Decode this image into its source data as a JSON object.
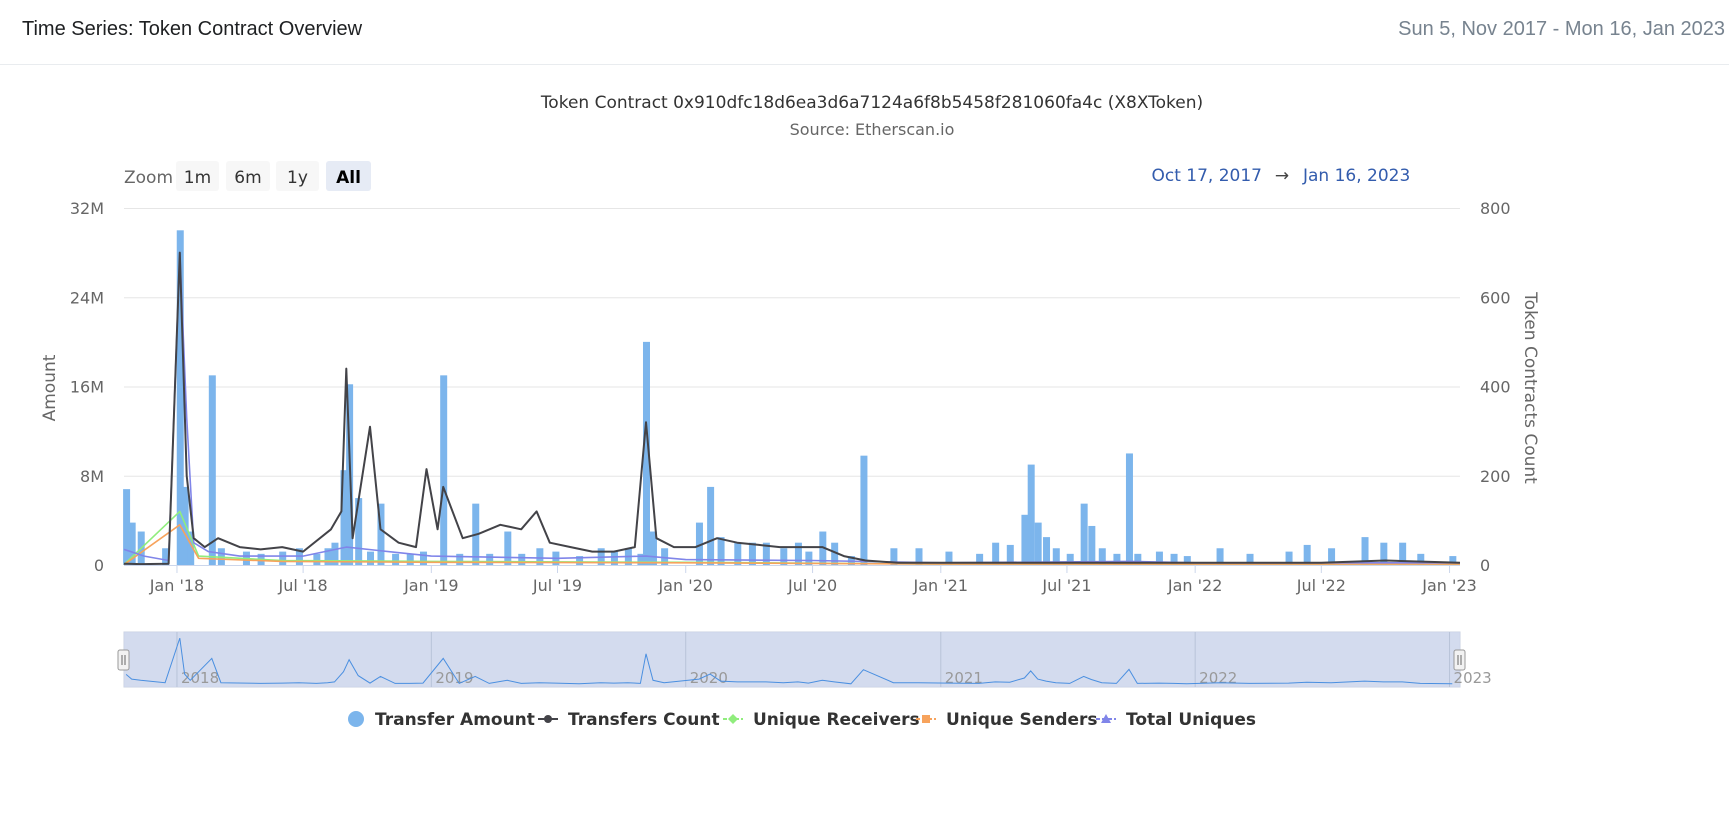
{
  "header": {
    "title": "Time Series: Token Contract Overview",
    "date_range": "Sun 5, Nov 2017 - Mon 16, Jan 2023"
  },
  "zoom": {
    "label": "Zoom",
    "buttons": [
      "1m",
      "6m",
      "1y",
      "All"
    ],
    "active": "All"
  },
  "range_display": {
    "from": "Oct 17, 2017",
    "arrow": "→",
    "to": "Jan 16, 2023"
  },
  "colors": {
    "transfer_amount": "#7cb5ec",
    "transfers_count": "#434348",
    "unique_receivers": "#90ed7d",
    "unique_senders": "#f7a35c",
    "total_uniques": "#8085e9",
    "navigator_fill": "#ccd6eb",
    "range_text": "#335cad"
  },
  "chart_data": {
    "type": "bar",
    "title": "Token Contract 0x910dfc18d6ea3d6a7124a6f8b5458f281060fa4c (X8XToken)",
    "subtitle": "Source: Etherscan.io",
    "xlabel": "",
    "ylabel": "Amount",
    "y2label": "Token Contracts Count",
    "x_range": [
      "2017-10-17",
      "2023-01-16"
    ],
    "ylim": [
      0,
      32000000
    ],
    "y2lim": [
      0,
      800
    ],
    "x_ticks": [
      "Jan '18",
      "Jul '18",
      "Jan '19",
      "Jul '19",
      "Jan '20",
      "Jul '20",
      "Jan '21",
      "Jul '21",
      "Jan '22",
      "Jul '22",
      "Jan '23"
    ],
    "x_tick_dates": [
      "2018-01-01",
      "2018-07-01",
      "2019-01-01",
      "2019-07-01",
      "2020-01-01",
      "2020-07-01",
      "2021-01-01",
      "2021-07-01",
      "2022-01-01",
      "2022-07-01",
      "2023-01-01"
    ],
    "y_ticks": [
      "0",
      "8M",
      "16M",
      "24M",
      "32M"
    ],
    "y_tick_values": [
      0,
      8000000,
      16000000,
      24000000,
      32000000
    ],
    "y2_ticks": [
      "0",
      "200",
      "400",
      "600",
      "800"
    ],
    "y2_tick_values": [
      0,
      200,
      400,
      600,
      800
    ],
    "navigator_years": [
      "2018",
      "2019",
      "2020",
      "2021",
      "2022",
      "2023"
    ],
    "navigator_year_dates": [
      "2018-01-01",
      "2019-01-01",
      "2020-01-01",
      "2021-01-01",
      "2022-01-01",
      "2023-01-01"
    ],
    "grid": true,
    "legend_position": "bottom",
    "series": [
      {
        "name": "Transfer Amount",
        "type": "bar",
        "axis": "left",
        "points": [
          [
            "2017-10-20",
            6800000
          ],
          [
            "2017-10-28",
            3800000
          ],
          [
            "2017-11-10",
            3000000
          ],
          [
            "2017-12-15",
            1500000
          ],
          [
            "2018-01-05",
            30000000
          ],
          [
            "2018-01-12",
            7000000
          ],
          [
            "2018-01-20",
            3000000
          ],
          [
            "2018-02-20",
            17000000
          ],
          [
            "2018-03-05",
            1500000
          ],
          [
            "2018-04-10",
            1200000
          ],
          [
            "2018-05-01",
            1000000
          ],
          [
            "2018-06-01",
            1200000
          ],
          [
            "2018-06-25",
            1500000
          ],
          [
            "2018-07-20",
            1000000
          ],
          [
            "2018-08-05",
            1500000
          ],
          [
            "2018-08-15",
            2000000
          ],
          [
            "2018-08-28",
            8500000
          ],
          [
            "2018-09-05",
            16200000
          ],
          [
            "2018-09-18",
            6000000
          ],
          [
            "2018-10-05",
            1200000
          ],
          [
            "2018-10-20",
            5500000
          ],
          [
            "2018-11-10",
            1000000
          ],
          [
            "2018-12-01",
            1000000
          ],
          [
            "2018-12-20",
            1200000
          ],
          [
            "2019-01-18",
            17000000
          ],
          [
            "2019-02-10",
            1000000
          ],
          [
            "2019-03-05",
            5500000
          ],
          [
            "2019-03-25",
            1000000
          ],
          [
            "2019-04-20",
            3000000
          ],
          [
            "2019-05-10",
            1000000
          ],
          [
            "2019-06-05",
            1500000
          ],
          [
            "2019-06-28",
            1200000
          ],
          [
            "2019-08-01",
            800000
          ],
          [
            "2019-09-01",
            1500000
          ],
          [
            "2019-09-20",
            1200000
          ],
          [
            "2019-10-10",
            1500000
          ],
          [
            "2019-10-28",
            1000000
          ],
          [
            "2019-11-05",
            20000000
          ],
          [
            "2019-11-15",
            3000000
          ],
          [
            "2019-12-01",
            1500000
          ],
          [
            "2020-01-20",
            3800000
          ],
          [
            "2020-02-05",
            7000000
          ],
          [
            "2020-02-20",
            2500000
          ],
          [
            "2020-03-15",
            2000000
          ],
          [
            "2020-04-05",
            2000000
          ],
          [
            "2020-04-25",
            2000000
          ],
          [
            "2020-05-20",
            1500000
          ],
          [
            "2020-06-10",
            2000000
          ],
          [
            "2020-06-25",
            1200000
          ],
          [
            "2020-07-15",
            3000000
          ],
          [
            "2020-08-01",
            2000000
          ],
          [
            "2020-08-25",
            800000
          ],
          [
            "2020-09-12",
            9800000
          ],
          [
            "2020-10-25",
            1500000
          ],
          [
            "2020-11-30",
            1500000
          ],
          [
            "2021-01-12",
            1200000
          ],
          [
            "2021-02-25",
            1000000
          ],
          [
            "2021-03-20",
            2000000
          ],
          [
            "2021-04-10",
            1800000
          ],
          [
            "2021-05-01",
            4500000
          ],
          [
            "2021-05-10",
            9000000
          ],
          [
            "2021-05-20",
            3800000
          ],
          [
            "2021-06-01",
            2500000
          ],
          [
            "2021-06-15",
            1500000
          ],
          [
            "2021-07-05",
            1000000
          ],
          [
            "2021-07-25",
            5500000
          ],
          [
            "2021-08-05",
            3500000
          ],
          [
            "2021-08-20",
            1500000
          ],
          [
            "2021-09-10",
            1000000
          ],
          [
            "2021-09-28",
            10000000
          ],
          [
            "2021-10-10",
            1000000
          ],
          [
            "2021-11-10",
            1200000
          ],
          [
            "2021-12-01",
            1000000
          ],
          [
            "2021-12-20",
            800000
          ],
          [
            "2022-02-05",
            1500000
          ],
          [
            "2022-03-20",
            1000000
          ],
          [
            "2022-05-15",
            1200000
          ],
          [
            "2022-06-10",
            1800000
          ],
          [
            "2022-07-15",
            1500000
          ],
          [
            "2022-09-01",
            2500000
          ],
          [
            "2022-09-28",
            2000000
          ],
          [
            "2022-10-25",
            2000000
          ],
          [
            "2022-11-20",
            1000000
          ],
          [
            "2023-01-05",
            800000
          ]
        ]
      },
      {
        "name": "Transfers Count",
        "type": "line",
        "axis": "right",
        "points": [
          [
            "2017-10-17",
            3
          ],
          [
            "2017-11-10",
            2
          ],
          [
            "2017-12-20",
            3
          ],
          [
            "2018-01-05",
            700
          ],
          [
            "2018-01-15",
            200
          ],
          [
            "2018-01-25",
            60
          ],
          [
            "2018-02-10",
            40
          ],
          [
            "2018-03-01",
            60
          ],
          [
            "2018-04-01",
            40
          ],
          [
            "2018-05-01",
            35
          ],
          [
            "2018-06-01",
            40
          ],
          [
            "2018-07-01",
            30
          ],
          [
            "2018-08-10",
            80
          ],
          [
            "2018-08-25",
            120
          ],
          [
            "2018-09-01",
            440
          ],
          [
            "2018-09-10",
            60
          ],
          [
            "2018-10-05",
            310
          ],
          [
            "2018-10-20",
            80
          ],
          [
            "2018-11-15",
            50
          ],
          [
            "2018-12-10",
            40
          ],
          [
            "2018-12-25",
            215
          ],
          [
            "2019-01-10",
            80
          ],
          [
            "2019-01-18",
            175
          ],
          [
            "2019-02-15",
            60
          ],
          [
            "2019-03-10",
            70
          ],
          [
            "2019-04-10",
            90
          ],
          [
            "2019-05-10",
            80
          ],
          [
            "2019-06-01",
            120
          ],
          [
            "2019-06-20",
            50
          ],
          [
            "2019-07-20",
            40
          ],
          [
            "2019-08-20",
            30
          ],
          [
            "2019-09-20",
            30
          ],
          [
            "2019-10-20",
            40
          ],
          [
            "2019-11-05",
            320
          ],
          [
            "2019-11-20",
            60
          ],
          [
            "2019-12-15",
            40
          ],
          [
            "2020-01-15",
            40
          ],
          [
            "2020-02-15",
            60
          ],
          [
            "2020-03-15",
            50
          ],
          [
            "2020-04-15",
            45
          ],
          [
            "2020-05-15",
            40
          ],
          [
            "2020-06-15",
            40
          ],
          [
            "2020-07-15",
            40
          ],
          [
            "2020-08-15",
            20
          ],
          [
            "2020-09-15",
            10
          ],
          [
            "2020-11-01",
            5
          ],
          [
            "2021-01-01",
            5
          ],
          [
            "2021-04-01",
            5
          ],
          [
            "2021-07-01",
            5
          ],
          [
            "2021-10-01",
            5
          ],
          [
            "2022-01-01",
            5
          ],
          [
            "2022-04-01",
            5
          ],
          [
            "2022-07-01",
            5
          ],
          [
            "2022-10-01",
            10
          ],
          [
            "2023-01-16",
            5
          ]
        ]
      },
      {
        "name": "Unique Receivers",
        "type": "line",
        "axis": "right",
        "points": [
          [
            "2017-10-17",
            1
          ],
          [
            "2018-01-05",
            120
          ],
          [
            "2018-02-01",
            20
          ],
          [
            "2018-06-01",
            10
          ],
          [
            "2019-01-01",
            8
          ],
          [
            "2020-01-01",
            6
          ],
          [
            "2021-01-01",
            2
          ],
          [
            "2023-01-16",
            2
          ]
        ]
      },
      {
        "name": "Unique Senders",
        "type": "line",
        "axis": "right",
        "points": [
          [
            "2017-10-17",
            1
          ],
          [
            "2018-01-05",
            90
          ],
          [
            "2018-02-01",
            15
          ],
          [
            "2018-06-01",
            8
          ],
          [
            "2019-01-01",
            6
          ],
          [
            "2020-01-01",
            5
          ],
          [
            "2021-01-01",
            2
          ],
          [
            "2023-01-16",
            2
          ]
        ]
      },
      {
        "name": "Total Uniques",
        "type": "line",
        "axis": "right",
        "points": [
          [
            "2017-10-17",
            35
          ],
          [
            "2017-11-15",
            20
          ],
          [
            "2017-12-20",
            10
          ],
          [
            "2018-01-05",
            700
          ],
          [
            "2018-01-15",
            330
          ],
          [
            "2018-01-25",
            50
          ],
          [
            "2018-02-15",
            30
          ],
          [
            "2018-04-01",
            20
          ],
          [
            "2018-07-01",
            20
          ],
          [
            "2018-09-01",
            40
          ],
          [
            "2019-01-01",
            20
          ],
          [
            "2019-07-01",
            15
          ],
          [
            "2019-11-05",
            20
          ],
          [
            "2020-01-01",
            12
          ],
          [
            "2020-07-01",
            10
          ],
          [
            "2021-01-01",
            5
          ],
          [
            "2021-09-28",
            8
          ],
          [
            "2022-01-01",
            5
          ],
          [
            "2023-01-16",
            5
          ]
        ]
      }
    ]
  },
  "legend": [
    {
      "label": "Transfer Amount",
      "icon": "circle",
      "color": "#7cb5ec"
    },
    {
      "label": "Transfers Count",
      "icon": "line-circle",
      "color": "#434348"
    },
    {
      "label": "Unique Receivers",
      "icon": "line-diamond",
      "color": "#90ed7d"
    },
    {
      "label": "Unique Senders",
      "icon": "line-square",
      "color": "#f7a35c"
    },
    {
      "label": "Total Uniques",
      "icon": "line-triangle",
      "color": "#8085e9"
    }
  ]
}
